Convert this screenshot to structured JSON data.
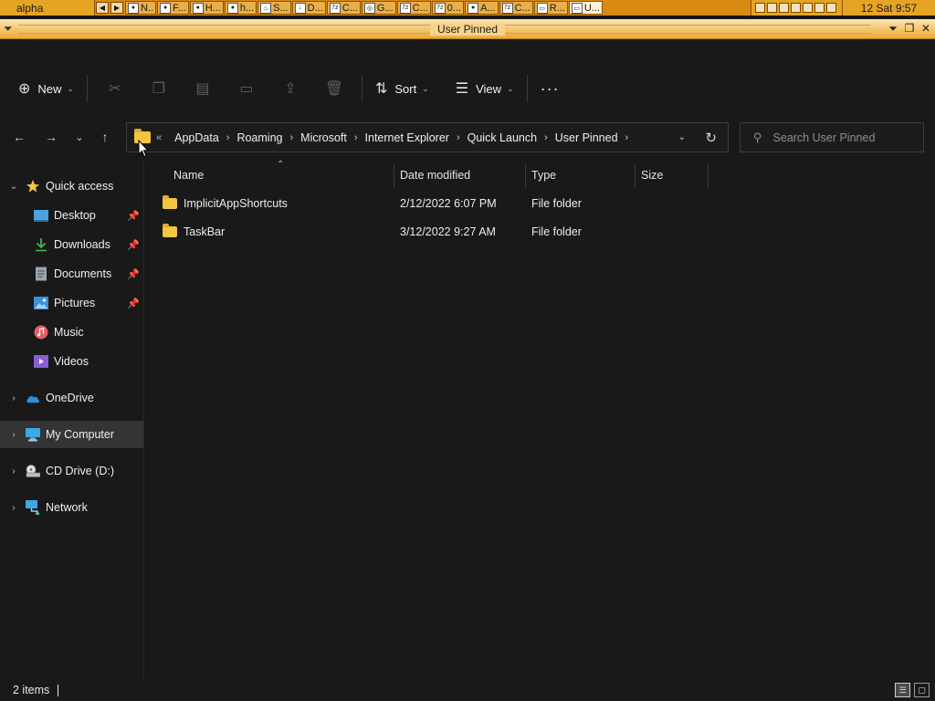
{
  "taskbar": {
    "workspace": "alpha",
    "tasks": [
      "N..",
      "F...",
      "H...",
      "h...",
      "S...",
      "D...",
      "C...",
      "G...",
      "C...",
      "0...",
      "A...",
      "C...",
      "R...",
      "U..."
    ],
    "clock": "12 Sat 9:57"
  },
  "window": {
    "title": "User Pinned"
  },
  "toolbar": {
    "new_label": "New",
    "sort_label": "Sort",
    "view_label": "View",
    "more_label": "···"
  },
  "address": {
    "overflow": "«",
    "segments": [
      "AppData",
      "Roaming",
      "Microsoft",
      "Internet Explorer",
      "Quick Launch",
      "User Pinned"
    ]
  },
  "search": {
    "placeholder": "Search User Pinned"
  },
  "sidebar": {
    "quick_access": "Quick access",
    "items": [
      {
        "label": "Desktop",
        "icon": "desktop-icon",
        "pinned": true
      },
      {
        "label": "Downloads",
        "icon": "downloads-icon",
        "pinned": true
      },
      {
        "label": "Documents",
        "icon": "documents-icon",
        "pinned": true
      },
      {
        "label": "Pictures",
        "icon": "pictures-icon",
        "pinned": true
      },
      {
        "label": "Music",
        "icon": "music-icon",
        "pinned": false
      },
      {
        "label": "Videos",
        "icon": "videos-icon",
        "pinned": false
      }
    ],
    "onedrive": "OneDrive",
    "my_computer": "My Computer",
    "cd_drive": "CD Drive (D:)",
    "network": "Network"
  },
  "columns": {
    "name": "Name",
    "date": "Date modified",
    "type": "Type",
    "size": "Size"
  },
  "files": [
    {
      "name": "ImplicitAppShortcuts",
      "date": "2/12/2022 6:07 PM",
      "type": "File folder"
    },
    {
      "name": "TaskBar",
      "date": "3/12/2022 9:27 AM",
      "type": "File folder"
    }
  ],
  "status": {
    "count": "2 items"
  },
  "colors": {
    "background": "#191919",
    "folder": "#f5c542",
    "selected": "#343434",
    "titlebar": "#f3c56b"
  }
}
